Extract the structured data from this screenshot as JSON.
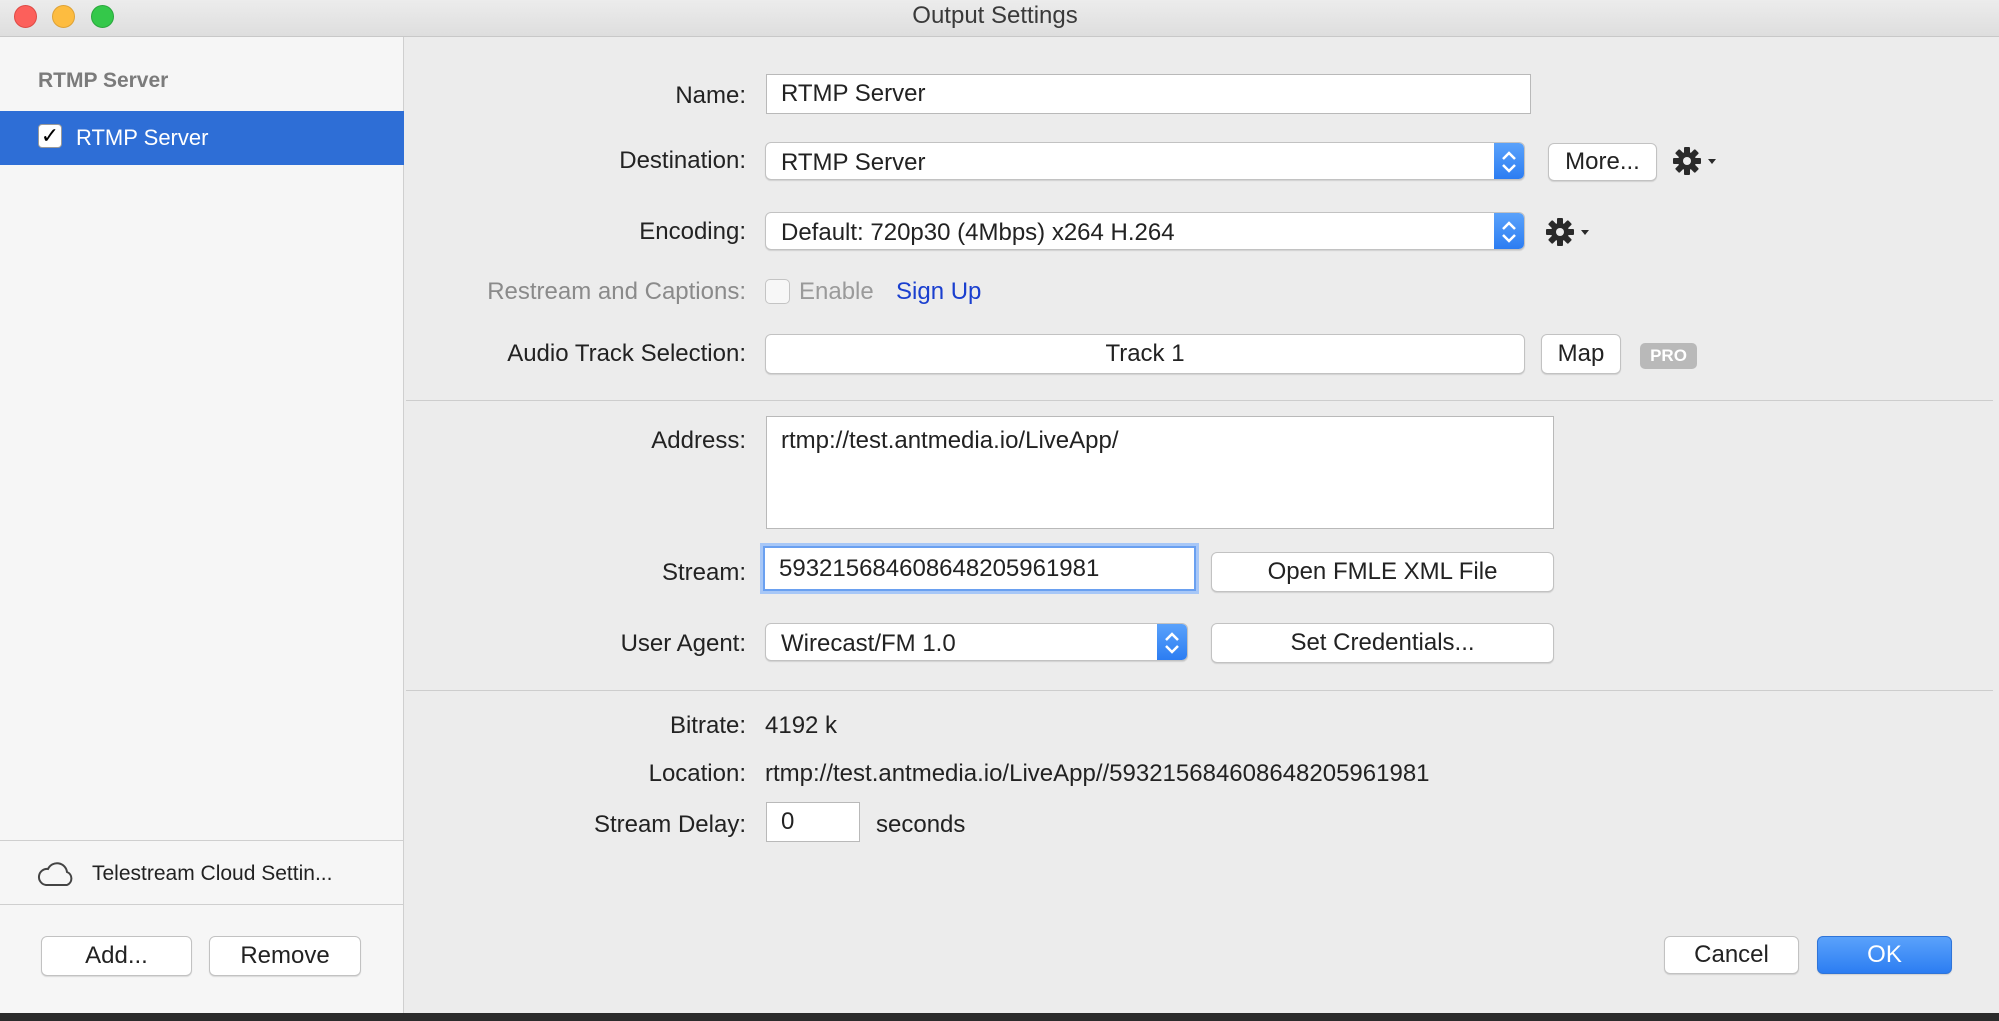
{
  "window": {
    "title": "Output Settings"
  },
  "sidebar": {
    "header": "RTMP Server",
    "items": [
      {
        "label": "RTMP Server",
        "checked": true,
        "selected": true
      }
    ],
    "cloud_label": "Telestream Cloud Settin...",
    "add_label": "Add...",
    "remove_label": "Remove"
  },
  "form": {
    "name_label": "Name:",
    "name_value": "RTMP Server",
    "destination_label": "Destination:",
    "destination_value": "RTMP Server",
    "more_label": "More...",
    "encoding_label": "Encoding:",
    "encoding_value": "Default: 720p30 (4Mbps) x264 H.264",
    "restream_label": "Restream and Captions:",
    "enable_label": "Enable",
    "signup_label": "Sign Up",
    "audio_label": "Audio Track Selection:",
    "audio_value": "Track 1",
    "map_label": "Map",
    "pro_badge": "PRO",
    "address_label": "Address:",
    "address_value": "rtmp://test.antmedia.io/LiveApp/",
    "stream_label": "Stream:",
    "stream_value": "593215684608648205961981",
    "open_fmle_label": "Open FMLE XML File",
    "user_agent_label": "User Agent:",
    "user_agent_value": "Wirecast/FM 1.0",
    "set_credentials_label": "Set Credentials...",
    "bitrate_label": "Bitrate:",
    "bitrate_value": "4192 k",
    "location_label": "Location:",
    "location_value": "rtmp://test.antmedia.io/LiveApp//593215684608648205961981",
    "delay_label": "Stream Delay:",
    "delay_value": "0",
    "delay_unit": "seconds"
  },
  "footer": {
    "cancel_label": "Cancel",
    "ok_label": "OK"
  },
  "colors": {
    "accent": "#2e6ed6",
    "link": "#1a3fcf",
    "window_bg": "#ececec"
  }
}
